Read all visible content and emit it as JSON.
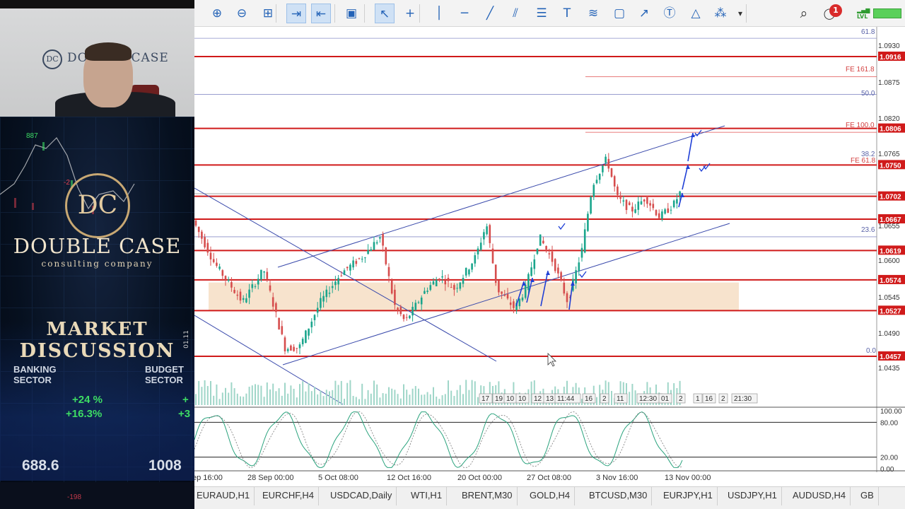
{
  "left_panel": {
    "webcam": {
      "brand_text": "DOUBLE CASE",
      "logo_text": "DC"
    },
    "promo": {
      "logo_mark": "DC",
      "company_name": "DOUBLE CASE",
      "company_sub": "consulting company",
      "title_line1": "MARKET",
      "title_line2": "DISCUSSION",
      "sector_left": "BANKING\nSECTOR",
      "sector_right": "BUDGET\nSECTOR",
      "pct_1": "+24 %",
      "pct_2": "+16.3%",
      "pct_3": "+",
      "pct_4": "+3",
      "big_left": "688.6",
      "big_right": "1008",
      "small_red": "-198",
      "green_value": "887",
      "red_value": "-2",
      "vertical_text": "01.11"
    }
  },
  "toolbar": {
    "buttons": [
      {
        "icon": "zoom-in-icon",
        "glyph": "⊕"
      },
      {
        "icon": "zoom-out-icon",
        "glyph": "⊖"
      },
      {
        "icon": "grid-icon",
        "glyph": "⊞"
      },
      {
        "icon": "autoscroll-icon",
        "glyph": "⇥"
      },
      {
        "icon": "chart-shift-icon",
        "glyph": "⇤"
      },
      {
        "icon": "screenshot-icon",
        "glyph": "▣"
      },
      {
        "icon": "cursor-icon",
        "glyph": "↖"
      },
      {
        "icon": "crosshair-icon",
        "glyph": "+"
      },
      {
        "icon": "vertical-line-icon",
        "glyph": "│"
      },
      {
        "icon": "horizontal-line-icon",
        "glyph": "─"
      },
      {
        "icon": "trendline-icon",
        "glyph": "╱"
      },
      {
        "icon": "equidistant-channel-icon",
        "glyph": "⫽"
      },
      {
        "icon": "fibonacci-icon",
        "glyph": "☰"
      },
      {
        "icon": "text-icon",
        "glyph": "T"
      },
      {
        "icon": "fibo-fan-icon",
        "glyph": "≋"
      },
      {
        "icon": "rectangle-icon",
        "glyph": "▢"
      },
      {
        "icon": "arrow-line-icon",
        "glyph": "↗"
      },
      {
        "icon": "text-label-icon",
        "glyph": "Ⓣ"
      },
      {
        "icon": "shapes-icon",
        "glyph": "△"
      },
      {
        "icon": "objects-icon",
        "glyph": "⁂"
      },
      {
        "icon": "dropdown-icon",
        "glyph": "▾"
      }
    ],
    "right": {
      "search_glyph": "⌕",
      "chat_glyph": "◯",
      "notif_count": "1",
      "lvl_label": "LVL",
      "signal_glyph": "▂▄▆"
    }
  },
  "chart_data": {
    "type": "candlestick",
    "price_axis_labels": [
      "61.8",
      "1.0930",
      "1.0916",
      "FE 161.8",
      "1.0875",
      "50.0",
      "1.0820",
      "FE 100.0",
      "1.0806",
      "38.2",
      "1.0765",
      "FE 61.8",
      "1.0750",
      "1.0702",
      "1.0667",
      "1.0655",
      "23.6",
      "1.0619",
      "1.0600",
      "1.0574",
      "1.0545",
      "1.0527",
      "1.0490",
      "0.0",
      "1.0457",
      "1.0435"
    ],
    "level_tags": [
      "1.0916",
      "1.0806",
      "1.0750",
      "1.0702",
      "1.0667",
      "1.0619",
      "1.0574",
      "1.0527",
      "1.0457"
    ],
    "time_labels": [
      "ep 16:00",
      "28 Sep 00:00",
      "5 Oct 08:00",
      "12 Oct 16:00",
      "20 Oct 00:00",
      "27 Oct 08:00",
      "3 Nov 16:00",
      "13 Nov 00:00"
    ],
    "separator_labels": [
      "17",
      "19",
      "10",
      "10",
      "12",
      "13",
      "11:44",
      "16",
      "2",
      "11",
      "12:30",
      "01",
      "2",
      "1",
      "16",
      "2",
      "21:30"
    ],
    "oscillator_levels": [
      "100.00",
      "80.00",
      "20.00",
      "0.00"
    ]
  },
  "tabs": [
    "EURAUD,H1",
    "EURCHF,H4",
    "USDCAD,Daily",
    "WTI,H1",
    "BRENT,M30",
    "GOLD,H4",
    "BTCUSD,M30",
    "EURJPY,H1",
    "USDJPY,H1",
    "AUDUSD,H4",
    "GB"
  ],
  "colors": {
    "level_line": "#d01a1a",
    "bull_candle": "#1aa58c",
    "bear_candle": "#d64d4d",
    "zone": "#f7e3cd",
    "channel": "#3949ab",
    "arrows": "#1f3fd6"
  }
}
